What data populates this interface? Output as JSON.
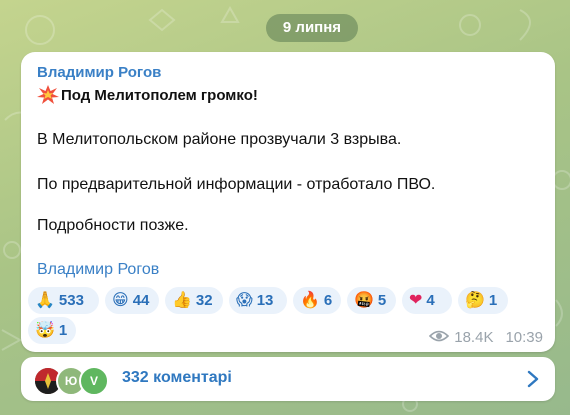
{
  "date_label": "9 липня",
  "post": {
    "author": "Владимир Рогов",
    "headline_icon": "collision-emoji",
    "headline": "Под Мелитополем громко!",
    "paragraphs": [
      "В Мелитопольском районе прозвучали 3 взрыва.",
      "По предварительной информации - отработало ПВО.",
      "Подробности позже."
    ],
    "signature": "Владимир Рогов",
    "reactions": [
      {
        "emoji": "🙏",
        "icon": "folded-hands-icon",
        "count": "533"
      },
      {
        "emoji": "😁",
        "icon": "grinning-face-icon",
        "count": "44"
      },
      {
        "emoji": "👍",
        "icon": "thumbs-up-icon",
        "count": "32"
      },
      {
        "emoji": "😱",
        "icon": "screaming-face-icon",
        "count": "13"
      },
      {
        "emoji": "🔥",
        "icon": "fire-icon",
        "count": "6"
      },
      {
        "emoji": "🤬",
        "icon": "cursing-face-icon",
        "count": "5"
      },
      {
        "emoji": "❤",
        "icon": "heart-icon",
        "count": "4"
      },
      {
        "emoji": "🤔",
        "icon": "thinking-face-icon",
        "count": "1"
      },
      {
        "emoji": "🤯",
        "icon": "exploding-head-icon",
        "count": "1"
      }
    ],
    "views": "18.4K",
    "time": "10:39"
  },
  "comments": {
    "avatars": [
      {
        "letters": "",
        "color": "#6a4b3d"
      },
      {
        "letters": "Ю",
        "color": "#8fb87a"
      },
      {
        "letters": "V",
        "color": "#5fb75f"
      }
    ],
    "label": "332 коментарі"
  },
  "colors": {
    "accent": "#3a80c6",
    "reaction_bg": "#eaf2fb",
    "bubble_bg": "#ffffff",
    "date_pill_bg": "#668458"
  }
}
